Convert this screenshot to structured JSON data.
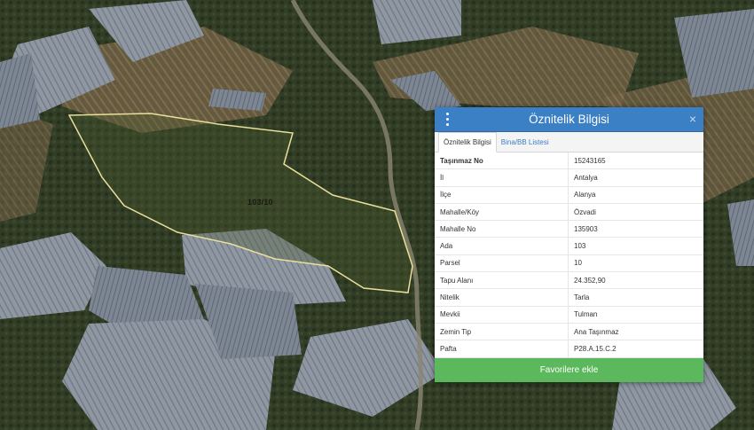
{
  "map": {
    "parcel_label": "103/10",
    "colors": {
      "terrain": "#3d4634",
      "greenhouse": "#8e97a2",
      "greenhouse_dark": "#6c7480",
      "field": "#7a6a4c",
      "parcel_outline": "#e8df9a",
      "vegetation": "#2e3a22"
    }
  },
  "panel": {
    "title": "Öznitelik Bilgisi",
    "menu_icon": "kebab-menu-icon",
    "close_icon": "close-icon",
    "close_glyph": "×",
    "tabs": [
      {
        "label": "Öznitelik Bilgisi",
        "active": true
      },
      {
        "label": "Bina/BB Listesi",
        "active": false
      }
    ],
    "rows": [
      {
        "key": "Taşınmaz No",
        "value": "15243165"
      },
      {
        "key": "İl",
        "value": "Antalya"
      },
      {
        "key": "İlçe",
        "value": "Alanya"
      },
      {
        "key": "Mahalle/Köy",
        "value": "Özvadi"
      },
      {
        "key": "Mahalle No",
        "value": "135903"
      },
      {
        "key": "Ada",
        "value": "103"
      },
      {
        "key": "Parsel",
        "value": "10"
      },
      {
        "key": "Tapu Alanı",
        "value": "24.352,90"
      },
      {
        "key": "Nitelik",
        "value": "Tarla"
      },
      {
        "key": "Mevkii",
        "value": "Tulman"
      },
      {
        "key": "Zemin Tip",
        "value": "Ana Taşınmaz"
      },
      {
        "key": "Pafta",
        "value": "P28.A.15.C.2"
      }
    ],
    "favorite_button": "Favorilere ekle",
    "colors": {
      "header": "#3b7fc4",
      "tab_link": "#3b7fc4",
      "button": "#5cb85c"
    }
  }
}
